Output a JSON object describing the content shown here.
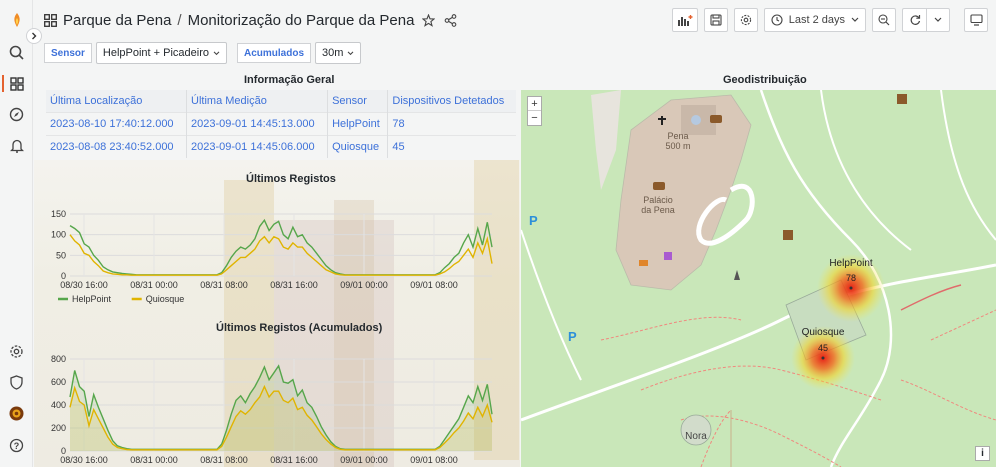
{
  "header": {
    "folder": "Parque da Pena",
    "separator": "/",
    "title": "Monitorização do Parque da Pena",
    "time_range": "Last 2 days"
  },
  "sidebar": {
    "items": [
      "grafana-logo-icon",
      "search-icon",
      "dashboards-icon",
      "explore-icon",
      "alerting-icon",
      "settings-icon",
      "shield-icon",
      "user-avatar",
      "help-icon"
    ]
  },
  "variables": {
    "sensor_label": "Sensor",
    "sensor_value": "HelpPoint + Picadeiro",
    "accum_label": "Acumulados",
    "accum_value": "30m"
  },
  "info_panel": {
    "title": "Informação Geral",
    "columns": [
      "Última Localização",
      "Última Medição",
      "Sensor",
      "Dispositivos Detetados"
    ],
    "rows": [
      [
        "2023-08-10 17:40:12.000",
        "2023-09-01 14:45:13.000",
        "HelpPoint",
        "78"
      ],
      [
        "2023-08-08 23:40:52.000",
        "2023-09-01 14:45:06.000",
        "Quiosque",
        "45"
      ]
    ]
  },
  "chart1_title": "Últimos Registos",
  "chart2_title": "Últimos Registos (Acumulados)",
  "map_panel": {
    "title": "Geodistribuição",
    "zoom_in": "+",
    "zoom_out": "−",
    "info": "i",
    "labels": {
      "pena": "Pena",
      "pena_alt": "500 m",
      "palacio_1": "Palácio",
      "palacio_2": "da Pena",
      "nora": "Nora",
      "helppoint": "HelpPoint",
      "helppoint_count": "78",
      "quiosque": "Quiosque",
      "quiosque_count": "45",
      "parking": "P"
    }
  },
  "colors": {
    "helppoint": "#56a64b",
    "quiosque": "#e0b400",
    "link": "#3d71d9"
  },
  "chart_data": [
    {
      "type": "line",
      "title": "Últimos Registos",
      "ylim": [
        0,
        150
      ],
      "yticks": [
        "0",
        "50",
        "100",
        "150"
      ],
      "xticks": [
        "08/30 16:00",
        "08/31 00:00",
        "08/31 08:00",
        "08/31 16:00",
        "09/01 00:00",
        "09/01 08:00"
      ],
      "legend_position": "bottom-left",
      "series": [
        {
          "name": "HelpPoint",
          "color": "#56a64b",
          "values": [
            122,
            115,
            105,
            78,
            70,
            50,
            38,
            22,
            15,
            10,
            8,
            6,
            5,
            4,
            3,
            3,
            3,
            3,
            3,
            3,
            3,
            3,
            3,
            3,
            3,
            3,
            3,
            3,
            3,
            3,
            3,
            3,
            8,
            25,
            45,
            60,
            70,
            65,
            75,
            90,
            120,
            135,
            110,
            125,
            132,
            100,
            90,
            118,
            95,
            100,
            80,
            70,
            55,
            40,
            25,
            15,
            8,
            5,
            3,
            3,
            3,
            3,
            3,
            3,
            3,
            3,
            3,
            3,
            3,
            3,
            3,
            3,
            3,
            3,
            3,
            3,
            3,
            3,
            8,
            20,
            30,
            45,
            55,
            80,
            100,
            70,
            115,
            75,
            130,
            70
          ]
        },
        {
          "name": "Quiosque",
          "color": "#e0b400",
          "values": [
            100,
            85,
            75,
            55,
            50,
            35,
            25,
            12,
            8,
            5,
            4,
            3,
            3,
            2,
            2,
            2,
            2,
            2,
            2,
            2,
            2,
            2,
            2,
            2,
            2,
            2,
            2,
            2,
            2,
            2,
            2,
            2,
            5,
            15,
            25,
            35,
            45,
            45,
            55,
            65,
            85,
            95,
            80,
            95,
            90,
            70,
            65,
            80,
            70,
            70,
            55,
            45,
            35,
            25,
            15,
            10,
            5,
            3,
            2,
            2,
            2,
            2,
            2,
            2,
            2,
            2,
            2,
            2,
            2,
            2,
            2,
            2,
            2,
            2,
            2,
            2,
            2,
            2,
            5,
            10,
            18,
            28,
            35,
            50,
            65,
            45,
            80,
            55,
            90,
            30
          ]
        }
      ]
    },
    {
      "type": "area",
      "title": "Últimos Registos (Acumulados)",
      "ylim": [
        0,
        800
      ],
      "yticks": [
        "0",
        "200",
        "400",
        "600",
        "800"
      ],
      "xticks": [
        "08/30 16:00",
        "08/31 00:00",
        "08/31 08:00",
        "08/31 16:00",
        "09/01 00:00",
        "09/01 08:00"
      ],
      "series": [
        {
          "name": "HelpPoint",
          "color": "#56a64b",
          "values": [
            470,
            700,
            560,
            520,
            300,
            490,
            380,
            280,
            180,
            90,
            45,
            30,
            20,
            15,
            15,
            15,
            15,
            15,
            15,
            15,
            15,
            15,
            15,
            15,
            15,
            15,
            15,
            15,
            15,
            15,
            15,
            15,
            60,
            180,
            320,
            440,
            480,
            420,
            500,
            560,
            640,
            730,
            620,
            680,
            740,
            600,
            590,
            620,
            480,
            530,
            420,
            380,
            300,
            210,
            140,
            80,
            40,
            20,
            15,
            15,
            15,
            15,
            15,
            15,
            15,
            15,
            15,
            15,
            15,
            15,
            15,
            15,
            15,
            15,
            15,
            15,
            15,
            15,
            40,
            100,
            160,
            220,
            280,
            380,
            480,
            420,
            560,
            440,
            580,
            320
          ]
        },
        {
          "name": "Quiosque",
          "color": "#e0b400",
          "values": [
            380,
            550,
            430,
            400,
            220,
            360,
            280,
            200,
            120,
            60,
            30,
            20,
            12,
            10,
            10,
            10,
            10,
            10,
            10,
            10,
            10,
            10,
            10,
            10,
            10,
            10,
            10,
            10,
            10,
            10,
            10,
            10,
            40,
            120,
            210,
            300,
            350,
            320,
            360,
            420,
            470,
            560,
            470,
            520,
            520,
            440,
            420,
            460,
            360,
            380,
            310,
            270,
            210,
            150,
            100,
            60,
            30,
            15,
            10,
            10,
            10,
            10,
            10,
            10,
            10,
            10,
            10,
            10,
            10,
            10,
            10,
            10,
            10,
            10,
            10,
            10,
            10,
            10,
            30,
            70,
            110,
            160,
            200,
            260,
            330,
            280,
            380,
            300,
            400,
            250
          ]
        }
      ]
    }
  ]
}
